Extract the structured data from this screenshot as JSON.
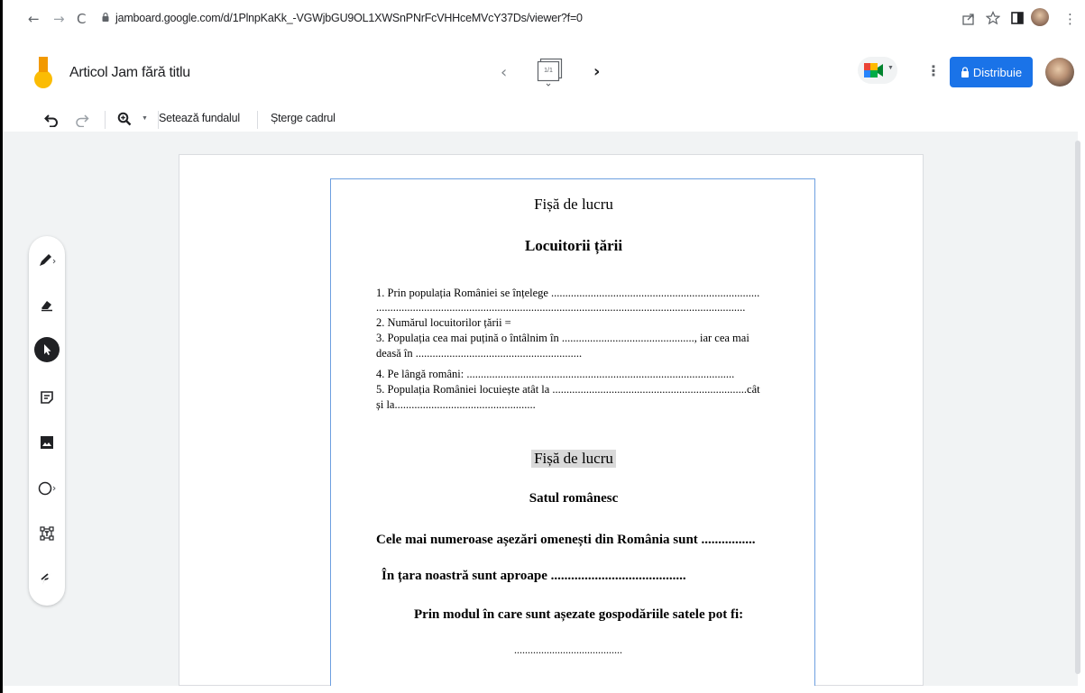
{
  "browser": {
    "back": "←",
    "forward": "→",
    "reload": "C",
    "url": "jamboard.google.com/d/1PlnpKaKk_-VGWjbGU9OL1XWSnPNrFcVHHceMVcY37Ds/viewer?f=0",
    "more": "⋮"
  },
  "header": {
    "doc_title": "Articol Jam fără titlu",
    "frame_prev": "‹",
    "frame_counter": "1/1",
    "frame_next": "›",
    "more": "⋮",
    "share_label": "Distribuie"
  },
  "toolbar": {
    "background_label": "Setează fundalul",
    "clear_label": "Șterge cadrul"
  },
  "worksheet1": {
    "title": "Fișă de lucru",
    "heading": "Locuitorii țării",
    "lines": [
      "1. Prin populația României se înțelege ..........................................................................",
      "...................................................................................................................................",
      "2. Numărul locuitorilor țării =",
      "3. Populația cea mai puțină o întâlnim în ..............................................., iar cea mai",
      "deasă în ...........................................................",
      "4. Pe lângă români: ...............................................................................................",
      "5. Populația României locuiește atât la .....................................................................cât",
      "și la.................................................."
    ]
  },
  "worksheet2": {
    "title": "Fișă de lucru",
    "heading": "Satul românesc",
    "line1": "Cele mai numeroase așezări omenești din România sunt ................",
    "line2": "În țara noastră sunt aproape ........................................",
    "line3": "Prin modul în care sunt așezate gospodăriile satele pot fi:",
    "line4": "........................................"
  },
  "colors": {
    "accent": "#1a73e8",
    "canvas": "#f1f3f4",
    "doc_border": "#6ea0e0"
  },
  "icons": [
    "back-icon",
    "forward-icon",
    "reload-icon",
    "lock-icon",
    "share-page-icon",
    "star-icon",
    "sidepanel-icon",
    "profile-icon",
    "jamboard-logo",
    "frame-prev-icon",
    "frames-icon",
    "frame-next-icon",
    "meet-icon",
    "more-icon",
    "lock-icon",
    "avatar",
    "undo-icon",
    "redo-icon",
    "zoom-icon",
    "pen-icon",
    "eraser-icon",
    "select-icon",
    "sticky-note-icon",
    "image-icon",
    "shape-icon",
    "textbox-icon",
    "laser-icon"
  ]
}
